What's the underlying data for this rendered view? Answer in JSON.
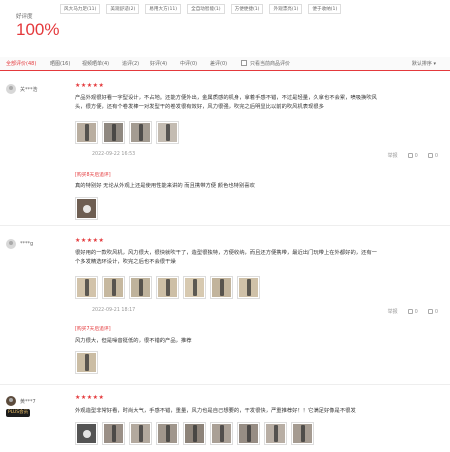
{
  "summary": {
    "rate_label": "好评度",
    "rate_value": "100%",
    "tags": [
      "风大马力足(11)",
      "美观舒适(2)",
      "易用大方(11)",
      "全自动智能(1)",
      "方便便捷(1)",
      "外观漂亮(1)",
      "便于收纳(1)"
    ]
  },
  "filters": {
    "items": [
      "全部评价(48)",
      "晒图(16)",
      "视频晒单(4)",
      "追评(2)",
      "好评(4)",
      "中评(0)",
      "差评(0)"
    ],
    "only_current": "只看当前商品评价",
    "sort": "默认排序 ▾"
  },
  "reviews": [
    {
      "user": "关***浩",
      "stars": "★★★★★",
      "text_lines": [
        "产品外观很好看一字型设计，不占地。还能方便外出，金属质感的机身，拿着手感不错，不过是轻量，久拿也不会累，喷吸换吹风",
        "头，很方便，还有个卷发棒一对发型干的卷发很有效好，风力很强，吹完之后明显比以前的吹风机表现很多"
      ],
      "date": "2022-09-22 16:53",
      "report": "举报",
      "likes": "0",
      "comments": "0",
      "addl_label": "[购买8天后追评]",
      "addl_text": "真的特别好 无论从外观上还是使用性能来讲的 而且携带方便 颜色也特别喜欢"
    },
    {
      "user": "****g",
      "stars": "★★★★★",
      "text_lines": [
        "很好用的一款吹风机，风力很大，很快就吹干了，造型很独特，方便收纳，而且还方便携带，最近出门玩带上在外都好的，还有一",
        "个多发精选环设计，吹完之后也不会很干燥"
      ],
      "date": "2022-09-21 18:17",
      "report": "举报",
      "likes": "0",
      "comments": "0",
      "addl_label": "[购买7天后追评]",
      "addl_text": "风力很大，但是噪音挺低的，很不错的产品，推荐"
    },
    {
      "user": "黄***7",
      "badge": "PLUS会员",
      "stars": "★★★★★",
      "text_lines": [
        "外观造型非常好看，时尚大气，手感不错，重量，风力也是自己想要的，干发很快，严重推荐好！！它满足好像是不很发"
      ]
    }
  ],
  "colors": {
    "accent": "#e4393c",
    "plus_badge_bg": "#1c1c1c",
    "plus_badge_text": "#f1c36b"
  }
}
